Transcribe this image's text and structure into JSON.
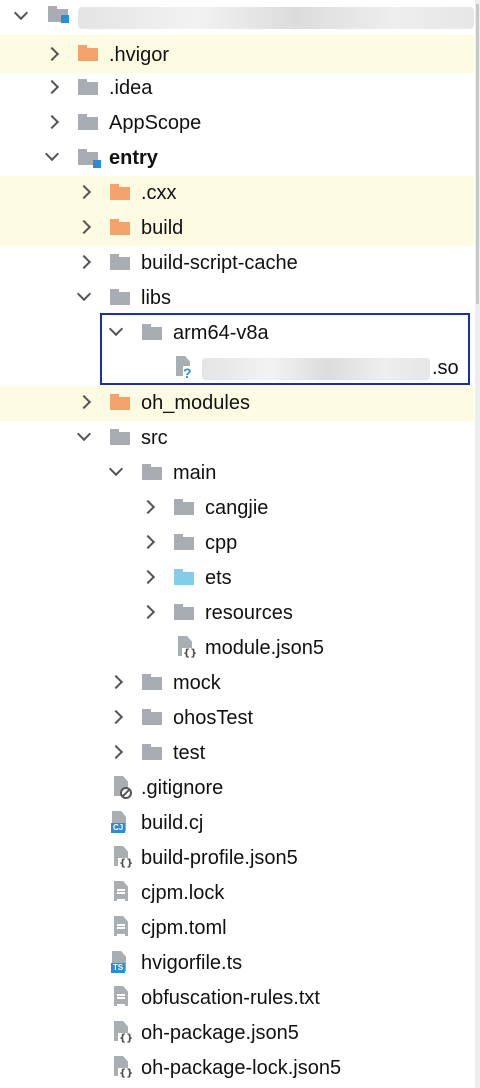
{
  "tree": {
    "root": {
      "name_hidden": true
    },
    "items": [
      {
        "label": ".hvigor",
        "type": "folder",
        "color": "orange",
        "state": "collapsed"
      },
      {
        "label": ".idea",
        "type": "folder",
        "color": "gray",
        "state": "collapsed"
      },
      {
        "label": "AppScope",
        "type": "folder",
        "color": "gray",
        "state": "collapsed"
      },
      {
        "label": "entry",
        "type": "module-folder",
        "color": "gray",
        "state": "expanded"
      },
      {
        "label": ".cxx",
        "type": "folder",
        "color": "orange",
        "state": "collapsed"
      },
      {
        "label": "build",
        "type": "folder",
        "color": "orange",
        "state": "collapsed"
      },
      {
        "label": "build-script-cache",
        "type": "folder",
        "color": "gray",
        "state": "collapsed"
      },
      {
        "label": "libs",
        "type": "folder",
        "color": "gray",
        "state": "expanded"
      },
      {
        "label": "arm64-v8a",
        "type": "folder",
        "color": "gray",
        "state": "expanded"
      },
      {
        "label": ".so",
        "type": "file-unknown",
        "name_hidden": true
      },
      {
        "label": "oh_modules",
        "type": "folder",
        "color": "orange",
        "state": "collapsed"
      },
      {
        "label": "src",
        "type": "folder",
        "color": "gray",
        "state": "expanded"
      },
      {
        "label": "main",
        "type": "folder",
        "color": "gray",
        "state": "expanded"
      },
      {
        "label": "cangjie",
        "type": "folder",
        "color": "gray",
        "state": "collapsed"
      },
      {
        "label": "cpp",
        "type": "folder",
        "color": "gray",
        "state": "collapsed"
      },
      {
        "label": "ets",
        "type": "folder",
        "color": "blue",
        "state": "collapsed"
      },
      {
        "label": "resources",
        "type": "folder",
        "color": "gray",
        "state": "collapsed"
      },
      {
        "label": "module.json5",
        "type": "file-json"
      },
      {
        "label": "mock",
        "type": "folder",
        "color": "gray",
        "state": "collapsed"
      },
      {
        "label": "ohosTest",
        "type": "folder",
        "color": "gray",
        "state": "collapsed"
      },
      {
        "label": "test",
        "type": "folder",
        "color": "gray",
        "state": "collapsed"
      },
      {
        "label": ".gitignore",
        "type": "file-ignore"
      },
      {
        "label": "build.cj",
        "type": "file-cj"
      },
      {
        "label": "build-profile.json5",
        "type": "file-json"
      },
      {
        "label": "cjpm.lock",
        "type": "file-text"
      },
      {
        "label": "cjpm.toml",
        "type": "file-text"
      },
      {
        "label": "hvigorfile.ts",
        "type": "file-ts"
      },
      {
        "label": "obfuscation-rules.txt",
        "type": "file-text"
      },
      {
        "label": "oh-package.json5",
        "type": "file-json"
      },
      {
        "label": "oh-package-lock.json5",
        "type": "file-json"
      }
    ],
    "icon_glyphs": {
      "json": "{}",
      "cj": "CJ",
      "ts": "TS",
      "unknown": "?"
    }
  },
  "colors": {
    "ignored_row_bg": "#fefbe3",
    "folder_gray": "#a7adb3",
    "folder_orange": "#f4a26c",
    "folder_blue": "#82cdeb",
    "selection_border": "#1c2fa8",
    "module_badge": "#2d8cd2"
  }
}
